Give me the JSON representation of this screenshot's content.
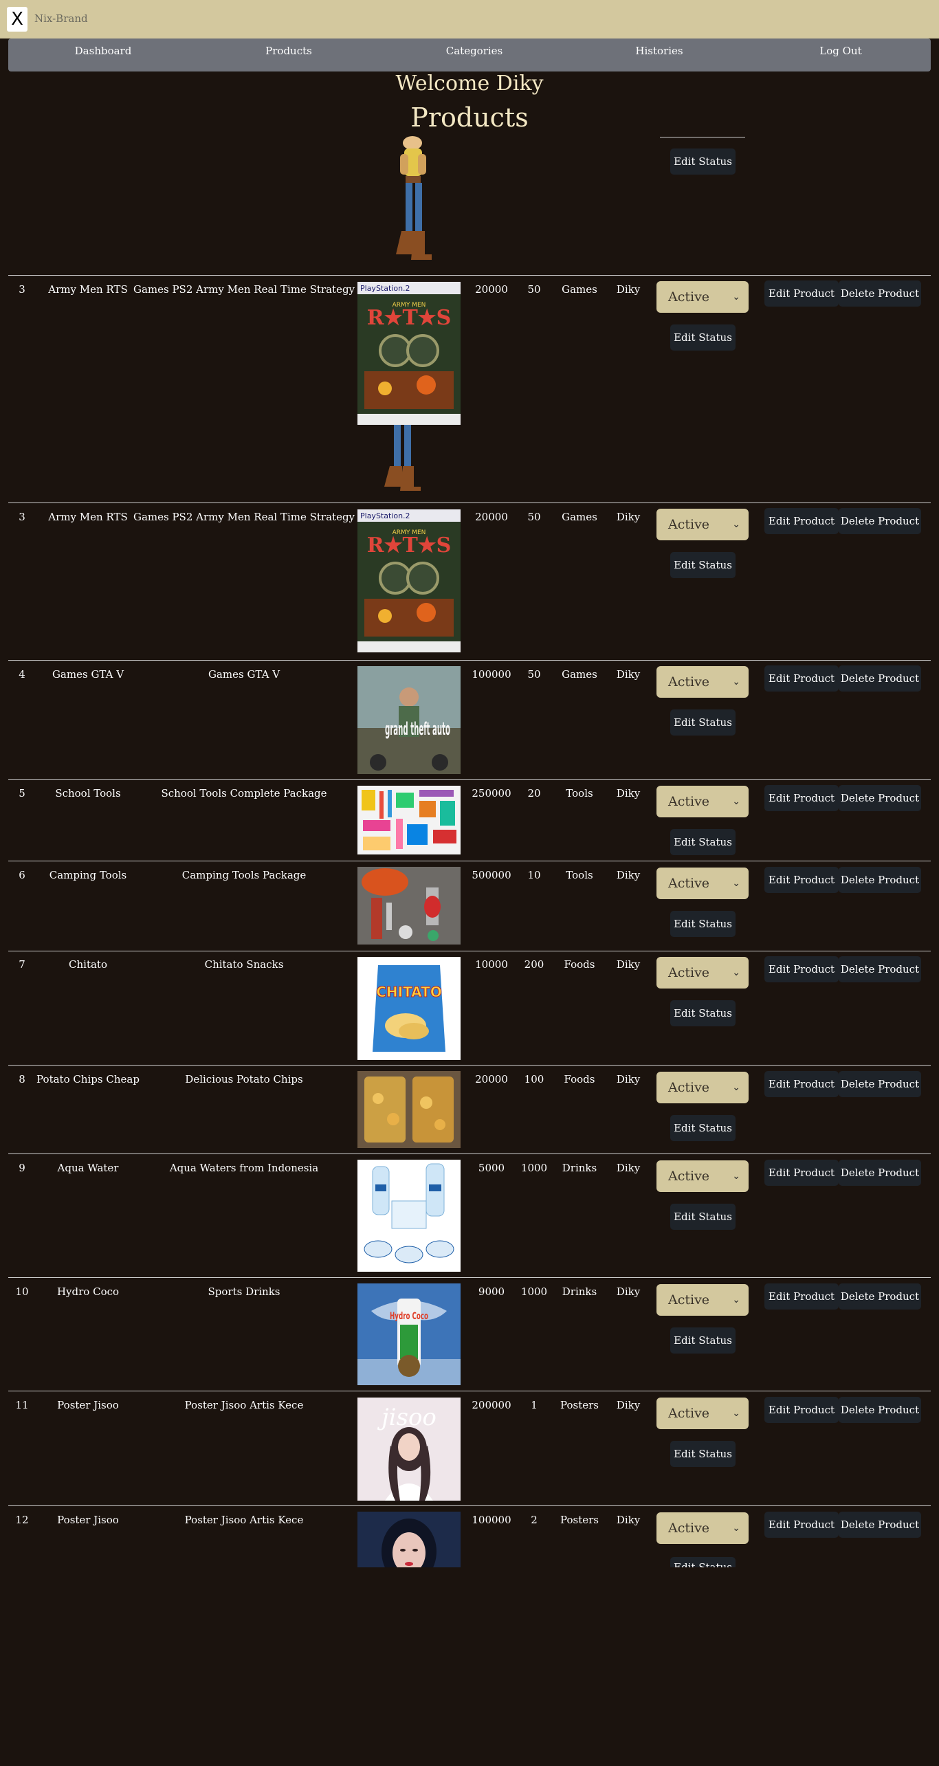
{
  "brand": {
    "logo_glyph": "X",
    "name": "Nix-Brand"
  },
  "nav": [
    "Dashboard",
    "Products",
    "Categories",
    "Histories",
    "Log Out"
  ],
  "welcome": "Welcome Diky",
  "title": "Products",
  "top_partial": {
    "edit_status_label": "Edit Status"
  },
  "buttons": {
    "edit_status": "Edit Status",
    "edit_product": "Edit Product",
    "delete_product": "Delete Product"
  },
  "rows": [
    {
      "id": "3",
      "name": "Army Men RTS",
      "description": "Games PS2 Army Men Real Time Strategy",
      "price": "20000",
      "stock": "50",
      "category": "Games",
      "owner": "Diky",
      "status": "Active"
    },
    {
      "id": "3",
      "name": "Army Men RTS",
      "description": "Games PS2 Army Men Real Time Strategy",
      "price": "20000",
      "stock": "50",
      "category": "Games",
      "owner": "Diky",
      "status": "Active"
    },
    {
      "id": "4",
      "name": "Games GTA V",
      "description": "Games GTA V",
      "price": "100000",
      "stock": "50",
      "category": "Games",
      "owner": "Diky",
      "status": "Active"
    },
    {
      "id": "5",
      "name": "School Tools",
      "description": "School Tools Complete Package",
      "price": "250000",
      "stock": "20",
      "category": "Tools",
      "owner": "Diky",
      "status": "Active"
    },
    {
      "id": "6",
      "name": "Camping Tools",
      "description": "Camping Tools Package",
      "price": "500000",
      "stock": "10",
      "category": "Tools",
      "owner": "Diky",
      "status": "Active"
    },
    {
      "id": "7",
      "name": "Chitato",
      "description": "Chitato Snacks",
      "price": "10000",
      "stock": "200",
      "category": "Foods",
      "owner": "Diky",
      "status": "Active"
    },
    {
      "id": "8",
      "name": "Potato Chips Cheap",
      "description": "Delicious Potato Chips",
      "price": "20000",
      "stock": "100",
      "category": "Foods",
      "owner": "Diky",
      "status": "Active"
    },
    {
      "id": "9",
      "name": "Aqua Water",
      "description": "Aqua Waters from Indonesia",
      "price": "5000",
      "stock": "1000",
      "category": "Drinks",
      "owner": "Diky",
      "status": "Active"
    },
    {
      "id": "10",
      "name": "Hydro Coco",
      "description": "Sports Drinks",
      "price": "9000",
      "stock": "1000",
      "category": "Drinks",
      "owner": "Diky",
      "status": "Active"
    },
    {
      "id": "11",
      "name": "Poster Jisoo",
      "description": "Poster Jisoo Artis Kece",
      "price": "200000",
      "stock": "1",
      "category": "Posters",
      "owner": "Diky",
      "status": "Active"
    },
    {
      "id": "12",
      "name": "Poster Jisoo",
      "description": "Poster Jisoo Artis Kece",
      "price": "100000",
      "stock": "2",
      "category": "Posters",
      "owner": "Diky",
      "status": "Active"
    }
  ],
  "image_art": {
    "ps2_brand": "PlayStation.2",
    "ps2_title": "R★T★S",
    "ps2_subtitle": "ARMY MEN",
    "gta_text": "grand theft auto",
    "chitato_text": "CHITATO",
    "hydro_text": "Hydro Coco",
    "jisoo_text": "jisoo"
  }
}
